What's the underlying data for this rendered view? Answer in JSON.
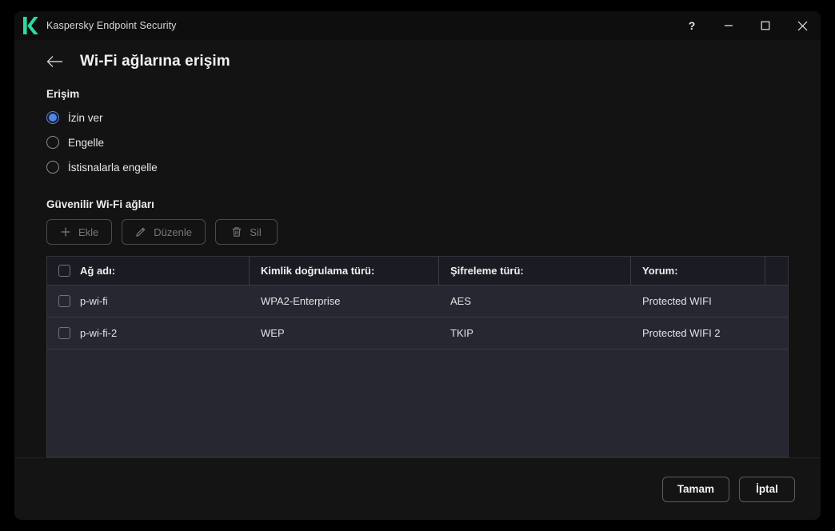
{
  "window": {
    "app_title": "Kaspersky Endpoint Security",
    "logo_color": "#2ed9a0",
    "logo_icon": "kaspersky-k-logo",
    "controls": {
      "help": "?",
      "help_icon": "help-icon",
      "minimize_icon": "minimize-icon",
      "maximize_icon": "maximize-icon",
      "close_icon": "close-icon"
    }
  },
  "header": {
    "back_icon": "back-arrow-icon",
    "title": "Wi-Fi ağlarına erişim"
  },
  "access": {
    "section_label": "Erişim",
    "selected_color": "#4f86ef",
    "options": [
      {
        "label": "İzin ver",
        "selected": true
      },
      {
        "label": "Engelle",
        "selected": false
      },
      {
        "label": "İstisnalarla engelle",
        "selected": false
      }
    ]
  },
  "trusted": {
    "section_label": "Güvenilir Wi-Fi ağları",
    "toolbar": [
      {
        "label": "Ekle",
        "icon": "plus-icon",
        "enabled": false
      },
      {
        "label": "Düzenle",
        "icon": "pencil-icon",
        "enabled": false
      },
      {
        "label": "Sil",
        "icon": "trash-icon",
        "enabled": false
      }
    ],
    "table": {
      "columns": [
        "Ağ adı:",
        "Kimlik doğrulama türü:",
        "Şifreleme türü:",
        "Yorum:"
      ],
      "select_all_checked": false,
      "rows": [
        {
          "checked": false,
          "name": "p-wi-fi",
          "auth": "WPA2-Enterprise",
          "encryption": "AES",
          "comment": "Protected WIFI"
        },
        {
          "checked": false,
          "name": "p-wi-fi-2",
          "auth": "WEP",
          "encryption": "TKIP",
          "comment": "Protected WIFI 2"
        }
      ]
    }
  },
  "footer": {
    "ok_label": "Tamam",
    "cancel_label": "İptal"
  }
}
